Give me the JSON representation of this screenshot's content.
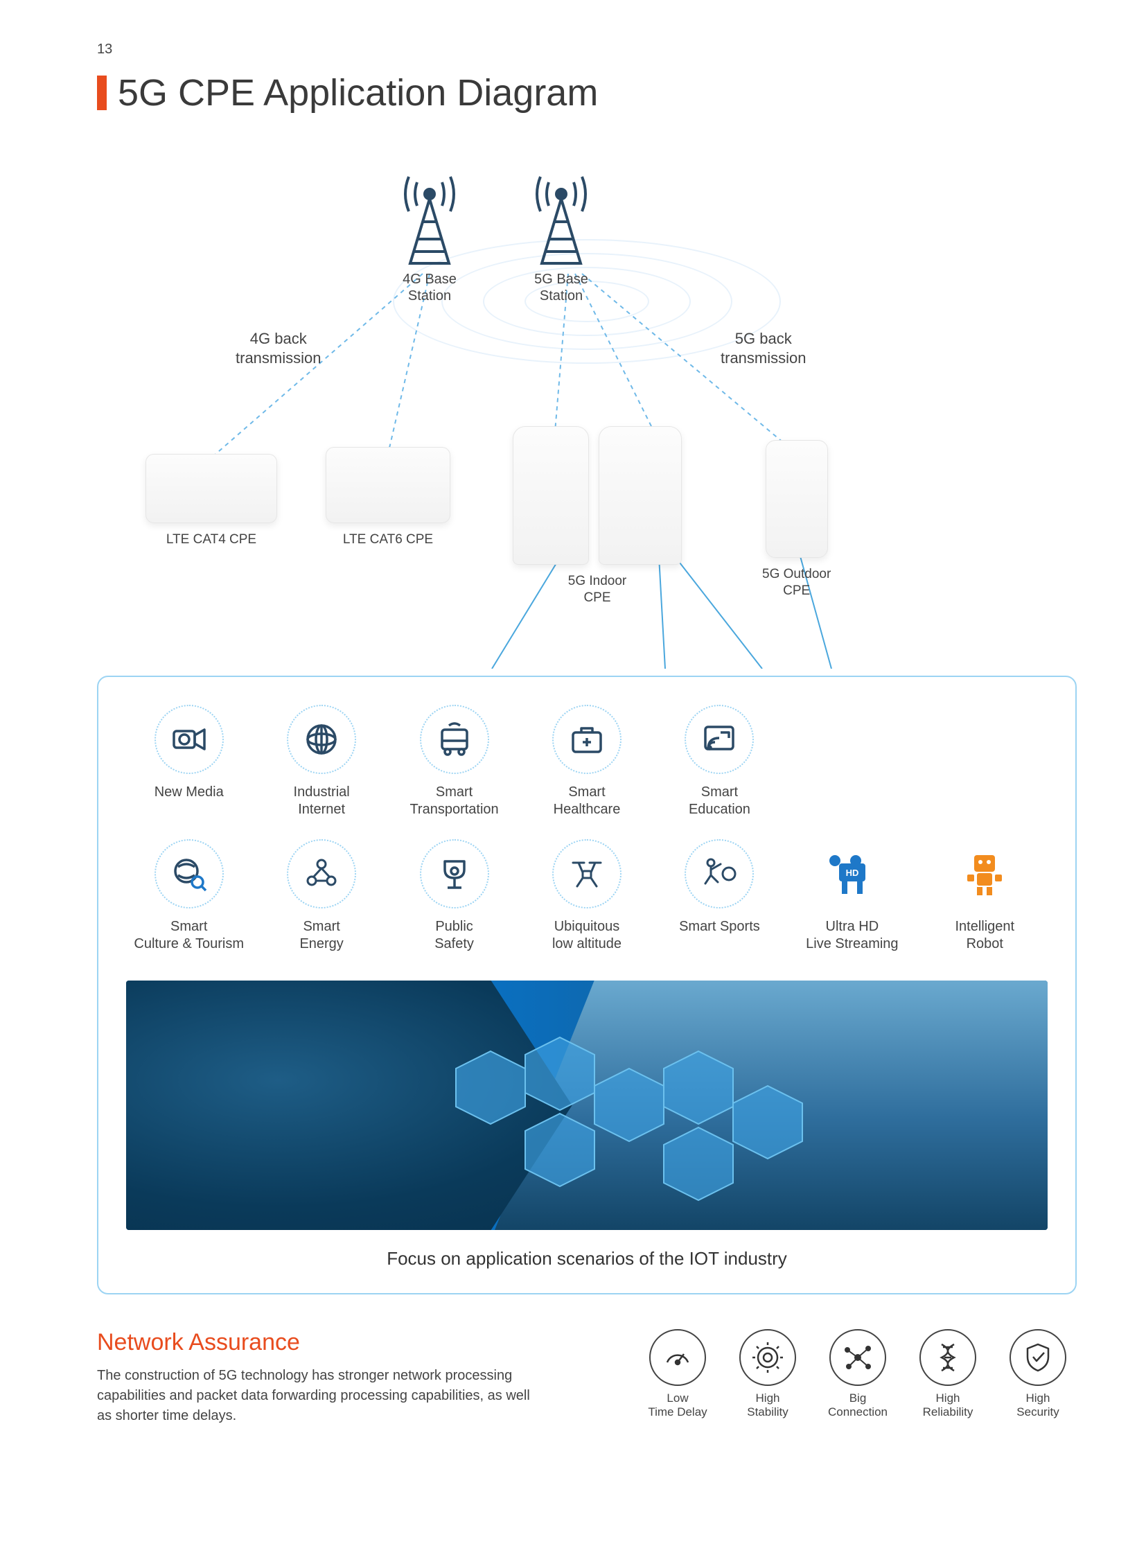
{
  "page_number": "13",
  "title": "5G CPE Application Diagram",
  "towers": {
    "t4g": {
      "label1": "4G Base",
      "label2": "Station"
    },
    "t5g": {
      "label1": "5G Base",
      "label2": "Station"
    }
  },
  "transmission": {
    "left": {
      "line1": "4G back",
      "line2": "transmission"
    },
    "right": {
      "line1": "5G back",
      "line2": "transmission"
    }
  },
  "devices": {
    "cat4": {
      "label": "LTE CAT4 CPE"
    },
    "cat6": {
      "label": "LTE CAT6 CPE"
    },
    "indoor": {
      "label1": "5G Indoor",
      "label2": "CPE"
    },
    "outdoor": {
      "label1": "5G Outdoor",
      "label2": "CPE"
    }
  },
  "scenarios_row1": [
    {
      "id": "new-media",
      "label": "New Media",
      "icon": "camera-icon"
    },
    {
      "id": "industrial-internet",
      "label": "Industrial\nInternet",
      "icon": "globe-icon"
    },
    {
      "id": "smart-transport",
      "label": "Smart\nTransportation",
      "icon": "bus-icon"
    },
    {
      "id": "smart-healthcare",
      "label": "Smart\nHealthcare",
      "icon": "medkit-icon"
    },
    {
      "id": "smart-education",
      "label": "Smart\nEducation",
      "icon": "cast-icon"
    }
  ],
  "scenarios_row2": [
    {
      "id": "smart-tourism",
      "label": "Smart\nCulture & Tourism",
      "icon": "earth-search-icon"
    },
    {
      "id": "smart-energy",
      "label": "Smart\nEnergy",
      "icon": "molecule-icon"
    },
    {
      "id": "public-safety",
      "label": "Public\nSafety",
      "icon": "cctv-icon"
    },
    {
      "id": "low-altitude",
      "label": "Ubiquitous\nlow altitude",
      "icon": "drone-icon"
    },
    {
      "id": "smart-sports",
      "label": "Smart Sports",
      "icon": "volleyball-icon"
    },
    {
      "id": "ultra-hd",
      "label": "Ultra HD\nLive Streaming",
      "icon": "hd-camera-icon"
    },
    {
      "id": "robot",
      "label": "Intelligent\nRobot",
      "icon": "robot-icon"
    }
  ],
  "banner_caption": "Focus on application scenarios of the IOT industry",
  "assurance": {
    "title": "Network Assurance",
    "text": "The construction of 5G technology has stronger network processing capabilities and packet data forwarding processing capabilities, as well as shorter time delays.",
    "items": [
      {
        "id": "low-delay",
        "label": "Low\nTime Delay",
        "icon": "gauge-icon"
      },
      {
        "id": "high-stability",
        "label": "High\nStability",
        "icon": "gear-target-icon"
      },
      {
        "id": "big-connection",
        "label": "Big\nConnection",
        "icon": "network-icon"
      },
      {
        "id": "high-reliability",
        "label": "High\nReliability",
        "icon": "dna-icon"
      },
      {
        "id": "high-security",
        "label": "High\nSecurity",
        "icon": "shield-check-icon"
      }
    ]
  }
}
